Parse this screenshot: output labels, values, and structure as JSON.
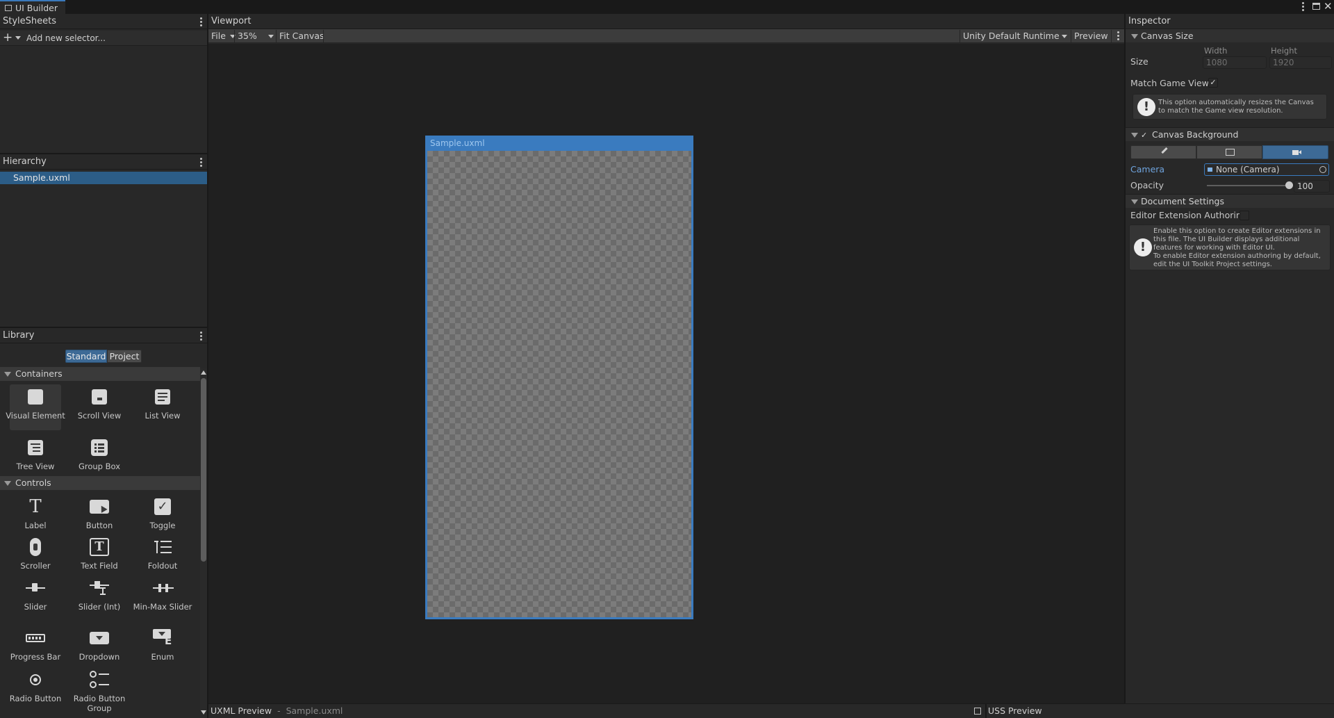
{
  "window": {
    "title": "UI Builder"
  },
  "stylesheets": {
    "title": "StyleSheets",
    "add_selector_placeholder": "Add new selector..."
  },
  "hierarchy": {
    "title": "Hierarchy",
    "items": [
      {
        "label": "Sample.uxml"
      }
    ]
  },
  "library": {
    "title": "Library",
    "tabs": [
      {
        "label": "Standard"
      },
      {
        "label": "Project"
      }
    ],
    "sections": [
      {
        "label": "Containers",
        "items": [
          {
            "label": "Visual Element",
            "icon": "visual-element-icon"
          },
          {
            "label": "Scroll View",
            "icon": "scroll-view-icon"
          },
          {
            "label": "List View",
            "icon": "list-view-icon"
          },
          {
            "label": "Tree View",
            "icon": "tree-view-icon"
          },
          {
            "label": "Group Box",
            "icon": "group-box-icon"
          }
        ]
      },
      {
        "label": "Controls",
        "items": [
          {
            "label": "Label",
            "icon": "label-icon"
          },
          {
            "label": "Button",
            "icon": "button-icon"
          },
          {
            "label": "Toggle",
            "icon": "toggle-icon"
          },
          {
            "label": "Scroller",
            "icon": "scroller-icon"
          },
          {
            "label": "Text Field",
            "icon": "text-field-icon"
          },
          {
            "label": "Foldout",
            "icon": "foldout-icon"
          },
          {
            "label": "Slider",
            "icon": "slider-icon"
          },
          {
            "label": "Slider (Int)",
            "icon": "slider-int-icon"
          },
          {
            "label": "Min-Max Slider",
            "icon": "min-max-slider-icon"
          },
          {
            "label": "Progress Bar",
            "icon": "progress-bar-icon"
          },
          {
            "label": "Dropdown",
            "icon": "dropdown-icon"
          },
          {
            "label": "Enum",
            "icon": "enum-icon"
          },
          {
            "label": "Radio Button",
            "icon": "radio-button-icon"
          },
          {
            "label": "Radio Button Group",
            "icon": "radio-button-group-icon"
          }
        ]
      }
    ]
  },
  "viewport": {
    "title": "Viewport",
    "file_menu": "File",
    "zoom": "35%",
    "fit_canvas": "Fit Canvas",
    "theme": "Unity Default Runtime ...",
    "preview": "Preview",
    "canvas_title": "Sample.uxml"
  },
  "bottom_bar": {
    "uxml_preview": "UXML Preview",
    "separator": "-",
    "file": "Sample.uxml",
    "uss_preview": "USS Preview"
  },
  "inspector": {
    "title": "Inspector",
    "canvas_size": {
      "header": "Canvas Size",
      "size_label": "Size",
      "width_label": "Width",
      "width_value": "1080",
      "height_label": "Height",
      "height_value": "1920",
      "match_game_view_label": "Match Game View",
      "match_game_view_checked": true,
      "help_text": "This option automatically resizes the Canvas to match the Game view resolution."
    },
    "canvas_background": {
      "header": "Canvas Background",
      "enabled": true,
      "camera_label": "Camera",
      "camera_value": "None (Camera)",
      "opacity_label": "Opacity",
      "opacity_value": "100"
    },
    "document_settings": {
      "header": "Document Settings",
      "editor_extension_label": "Editor Extension Authoring",
      "help_line1": "Enable this option to create Editor extensions in this file. The UI Builder displays additional features for working with Editor UI.",
      "help_line2": "To enable Editor extension authoring by default, edit the UI Toolkit Project settings."
    }
  },
  "colors": {
    "accent": "#2c5d87",
    "selection": "#2c5d87",
    "canvas_border": "#3a7bbf",
    "background": "#282828"
  }
}
